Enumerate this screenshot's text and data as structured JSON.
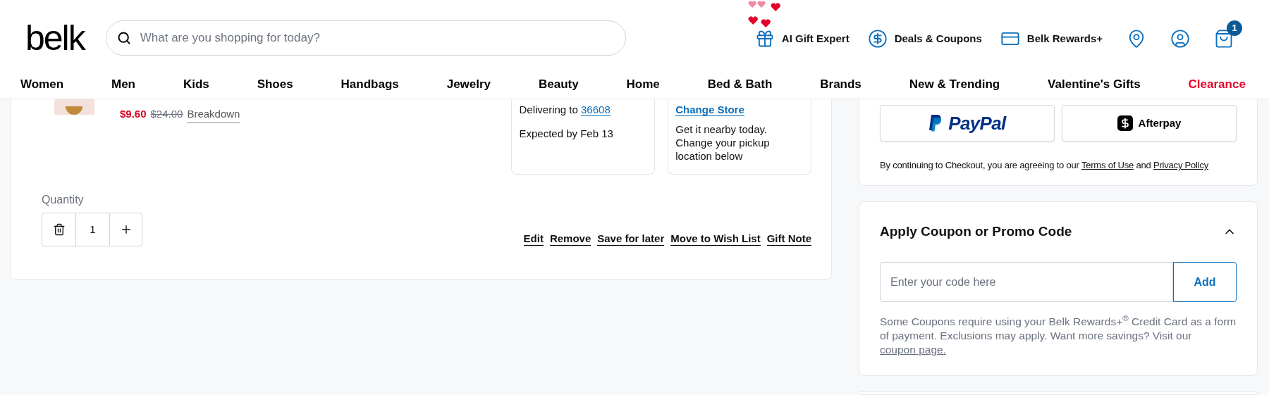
{
  "header": {
    "logo": "belk",
    "search": {
      "placeholder": "What are you shopping for today?"
    },
    "utilities": [
      {
        "kind": "gift",
        "label": "AI Gift Expert"
      },
      {
        "kind": "deals",
        "label": "Deals & Coupons"
      },
      {
        "kind": "rewards",
        "label": "Belk Rewards+"
      }
    ],
    "cart_badge": "1"
  },
  "nav": [
    {
      "label": "Women",
      "highlight": false
    },
    {
      "label": "Men",
      "highlight": false
    },
    {
      "label": "Kids",
      "highlight": false
    },
    {
      "label": "Shoes",
      "highlight": false
    },
    {
      "label": "Handbags",
      "highlight": false
    },
    {
      "label": "Jewelry",
      "highlight": false
    },
    {
      "label": "Beauty",
      "highlight": false
    },
    {
      "label": "Home",
      "highlight": false
    },
    {
      "label": "Bed & Bath",
      "highlight": false
    },
    {
      "label": "Brands",
      "highlight": false
    },
    {
      "label": "New & Trending",
      "highlight": false
    },
    {
      "label": "Valentine's Gifts",
      "highlight": false
    },
    {
      "label": "Clearance",
      "highlight": true
    }
  ],
  "cart_item": {
    "sale_price": "$9.60",
    "original_price": "$24.00",
    "breakdown": "Breakdown",
    "shipping": {
      "label": "Delivering to",
      "zip": "36608",
      "expected": "Expected by Feb 13"
    },
    "pickup": {
      "link": "Change Store",
      "text": "Get it nearby today. Change your pickup location below"
    },
    "quantity": {
      "label": "Quantity",
      "value": "1"
    },
    "actions": [
      "Edit",
      "Remove",
      "Save for later",
      "Move to Wish List",
      "Gift Note"
    ]
  },
  "checkout": {
    "payment_buttons": [
      {
        "kind": "paypal",
        "label": "PayPal"
      },
      {
        "kind": "afterpay",
        "label": "Afterpay"
      }
    ],
    "terms": {
      "before": "By continuing to Checkout, you are agreeing to our",
      "link_1": "Terms of Use",
      "middle": "and",
      "link_2": "Privacy Policy"
    }
  },
  "coupon": {
    "title": "Apply Coupon or Promo Code",
    "expanded": true,
    "placeholder": "Enter your code here",
    "button": "Add",
    "note": "Some Coupons require using your Belk Rewards+$^{®}$ Credit Card as a form of payment. Exclusions may apply. Want more savings? Visit our",
    "note_link": "coupon page."
  }
}
